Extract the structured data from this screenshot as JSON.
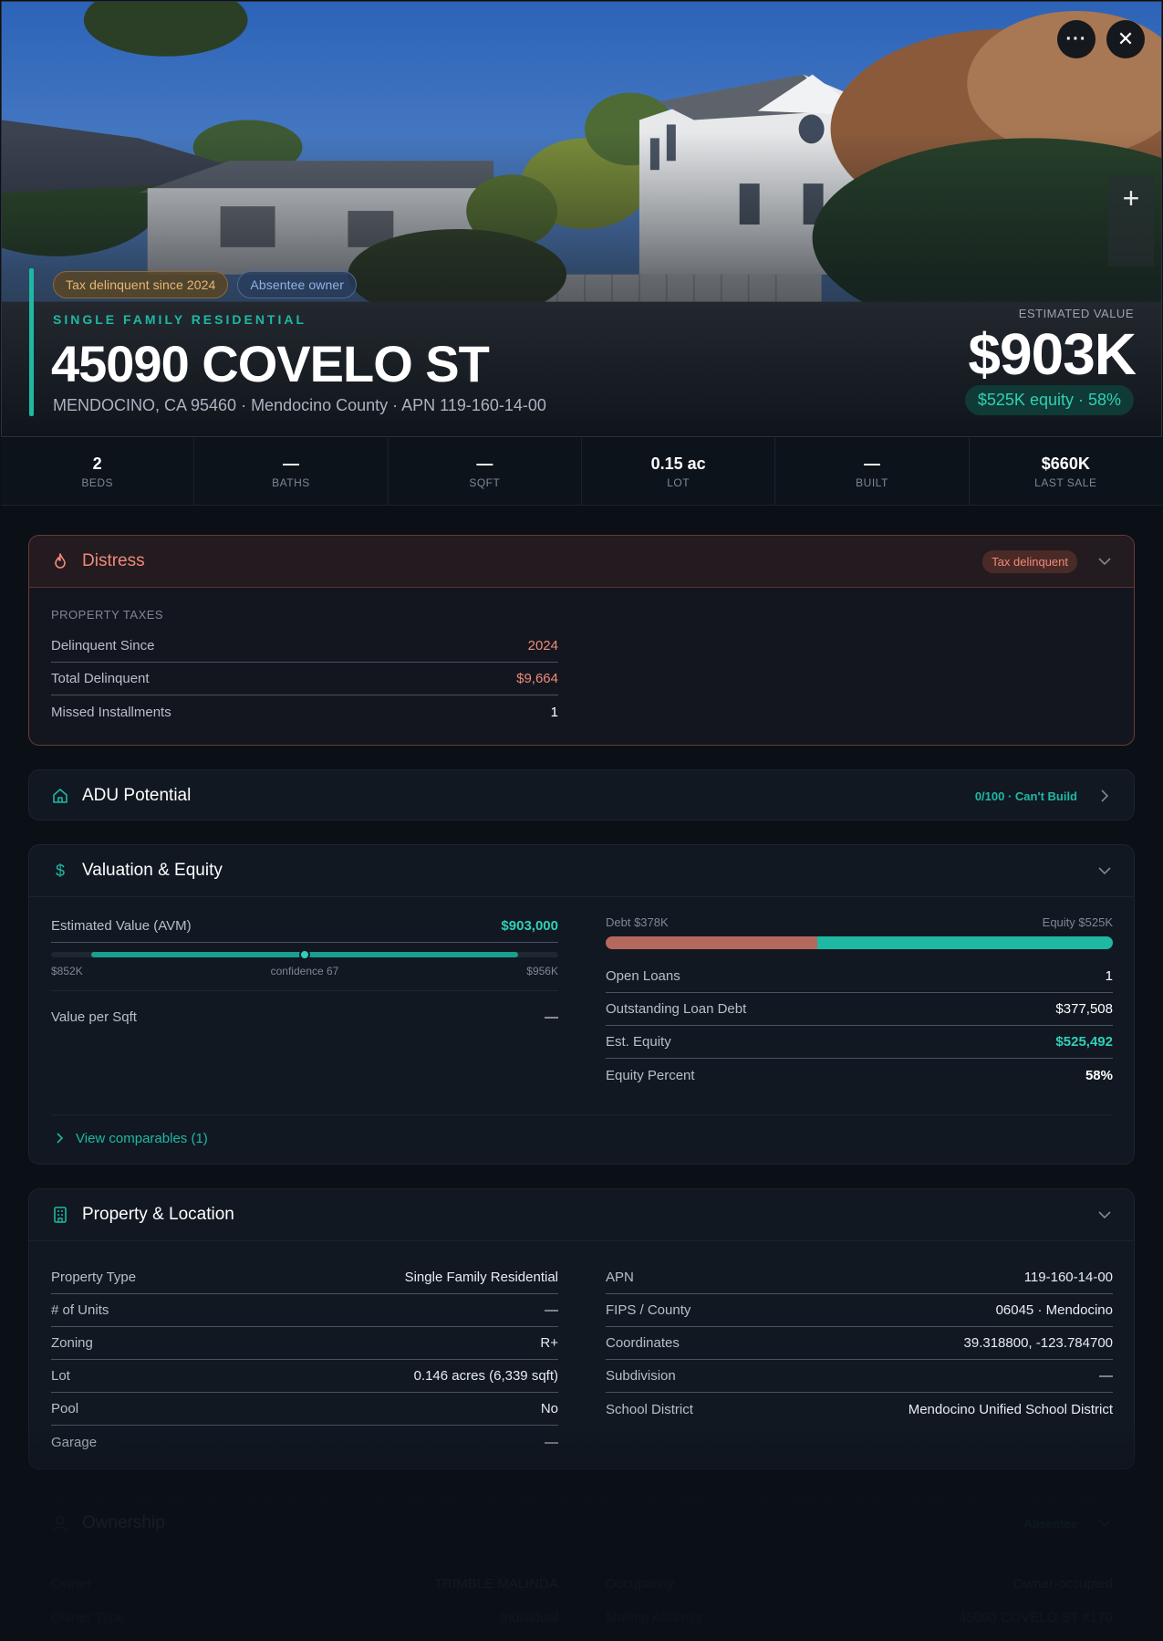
{
  "hero": {
    "tags": [
      "Tax delinquent since 2024",
      "Absentee owner"
    ],
    "property_type": "SINGLE FAMILY RESIDENTIAL",
    "address": "45090 COVELO ST",
    "subtitle": "MENDOCINO, CA 95460 · Mendocino County · APN 119-160-14-00",
    "estimated_value_label": "ESTIMATED VALUE",
    "estimated_value": "$903K",
    "equity_badge": "$525K equity · 58%",
    "more_button": "···",
    "close_button": "✕",
    "zoom_in": "+"
  },
  "stats": [
    {
      "value": "2",
      "label": "BEDS"
    },
    {
      "value": "—",
      "label": "BATHS"
    },
    {
      "value": "—",
      "label": "SQFT"
    },
    {
      "value": "0.15 ac",
      "label": "LOT"
    },
    {
      "value": "—",
      "label": "BUILT"
    },
    {
      "value": "$660K",
      "label": "LAST SALE"
    }
  ],
  "distress": {
    "title": "Distress",
    "badge": "Tax delinquent",
    "section_label": "PROPERTY TAXES",
    "rows": [
      {
        "label": "Delinquent Since",
        "value": "2024"
      },
      {
        "label": "Total Delinquent",
        "value": "$9,664"
      },
      {
        "label": "Missed Installments",
        "value": "1"
      }
    ]
  },
  "adu": {
    "title": "ADU Potential",
    "score": "0/100 · Can't Build"
  },
  "valuation": {
    "title": "Valuation & Equity",
    "avm_label": "Estimated Value (AVM)",
    "avm_value": "$903,000",
    "range_low": "$852K",
    "range_mid": "confidence 67",
    "range_high": "$956K",
    "range_fill_start": 0.08,
    "range_fill_end": 0.92,
    "range_marker": 0.5,
    "value_per_sqft_label": "Value per Sqft",
    "value_per_sqft": "—",
    "debt_label": "Debt $378K",
    "equity_label": "Equity $525K",
    "debt_fraction": 0.418,
    "rows": [
      {
        "label": "Open Loans",
        "value": "1"
      },
      {
        "label": "Outstanding Loan Debt",
        "value": "$377,508"
      },
      {
        "label": "Est. Equity",
        "value": "$525,492"
      },
      {
        "label": "Equity Percent",
        "value": "58%"
      }
    ],
    "comparables": "View comparables (1)"
  },
  "property": {
    "title": "Property & Location",
    "left": [
      {
        "label": "Property Type",
        "value": "Single Family Residential"
      },
      {
        "label": "# of Units",
        "value": "—"
      },
      {
        "label": "Zoning",
        "value": "R+"
      },
      {
        "label": "Lot",
        "value": "0.146 acres (6,339 sqft)"
      },
      {
        "label": "Pool",
        "value": "No"
      },
      {
        "label": "Garage",
        "value": "—"
      }
    ],
    "right": [
      {
        "label": "APN",
        "value": "119-160-14-00"
      },
      {
        "label": "FIPS / County",
        "value": "06045 · Mendocino"
      },
      {
        "label": "Coordinates",
        "value": "39.318800, -123.784700"
      },
      {
        "label": "Subdivision",
        "value": "—"
      },
      {
        "label": "School District",
        "value": "Mendocino Unified School District"
      }
    ]
  },
  "ownership": {
    "title": "Ownership",
    "badge": "Absentee",
    "left": [
      {
        "label": "Owner",
        "value": "TRIMBLE MALINDA"
      },
      {
        "label": "Owner Type",
        "value": "Individual"
      }
    ],
    "right": [
      {
        "label": "Occupancy",
        "value": "Owner-occupied"
      },
      {
        "label": "Mailing Address",
        "value": "45090 COVELO ST #170"
      }
    ]
  },
  "colors": {
    "accent": "#1fb8a3",
    "danger": "#ee8a79",
    "debt": "#b5685e"
  }
}
